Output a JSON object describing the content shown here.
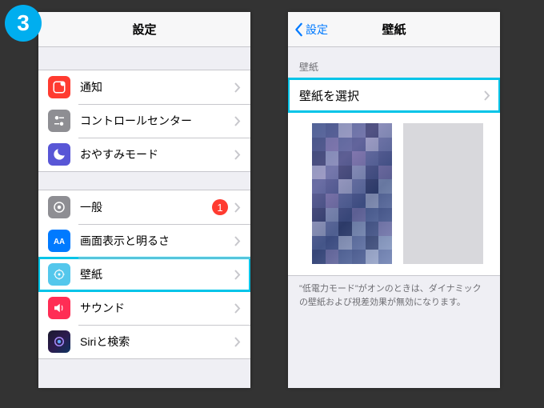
{
  "step_number": "3",
  "left": {
    "title": "設定",
    "group1": [
      {
        "icon": "notify",
        "label": "通知"
      },
      {
        "icon": "control",
        "label": "コントロールセンター"
      },
      {
        "icon": "dnd",
        "label": "おやすみモード"
      }
    ],
    "group2": [
      {
        "icon": "general",
        "label": "一般",
        "badge": "1"
      },
      {
        "icon": "display",
        "label": "画面表示と明るさ"
      },
      {
        "icon": "wall",
        "label": "壁紙",
        "highlighted": true
      },
      {
        "icon": "sound",
        "label": "サウンド"
      },
      {
        "icon": "siri",
        "label": "Siriと検索"
      }
    ]
  },
  "right": {
    "back_label": "設定",
    "title": "壁紙",
    "section_header": "壁紙",
    "choose_label": "壁紙を選択",
    "footnote": "\"低電力モード\"がオンのときは、ダイナミックの壁紙および視差効果が無効になります。"
  }
}
